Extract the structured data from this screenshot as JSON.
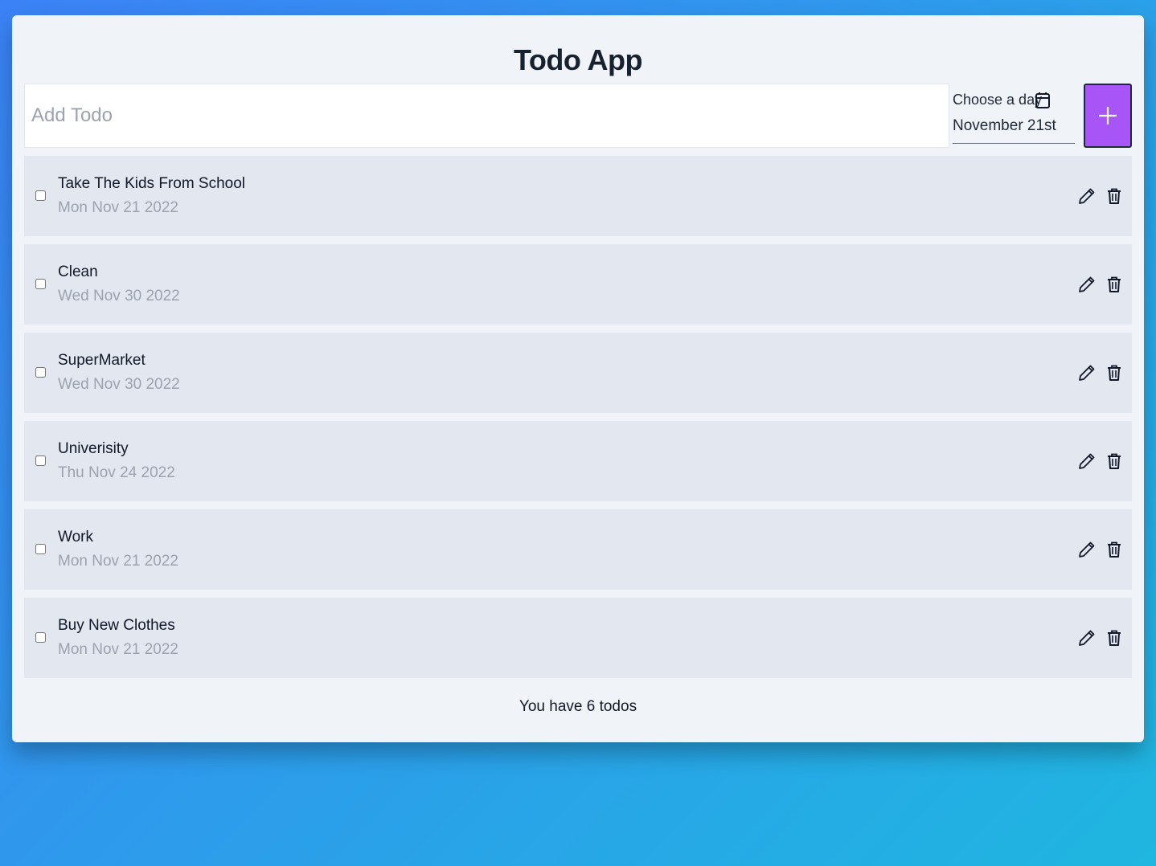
{
  "app": {
    "title": "Todo App"
  },
  "input": {
    "placeholder": "Add Todo",
    "value": ""
  },
  "date_picker": {
    "label": "Choose a day",
    "value": "November 21st",
    "icon": "calendar-icon"
  },
  "add_button": {
    "icon": "plus-icon",
    "color": "#a855f7"
  },
  "todos": [
    {
      "text": "Take The Kids From School",
      "date": "Mon Nov 21 2022",
      "done": false
    },
    {
      "text": "Clean",
      "date": "Wed Nov 30 2022",
      "done": false
    },
    {
      "text": "SuperMarket",
      "date": "Wed Nov 30 2022",
      "done": false
    },
    {
      "text": "Univerisity",
      "date": "Thu Nov 24 2022",
      "done": false
    },
    {
      "text": "Work",
      "date": "Mon Nov 21 2022",
      "done": false
    },
    {
      "text": "Buy New Clothes",
      "date": "Mon Nov 21 2022",
      "done": false
    }
  ],
  "footer": {
    "count_text": "You have 6 todos"
  },
  "colors": {
    "background_start": "#3b82f6",
    "background_end": "#1fb6e0",
    "card": "#f0f3f8",
    "item": "#e2e7f0",
    "accent": "#a855f7"
  }
}
